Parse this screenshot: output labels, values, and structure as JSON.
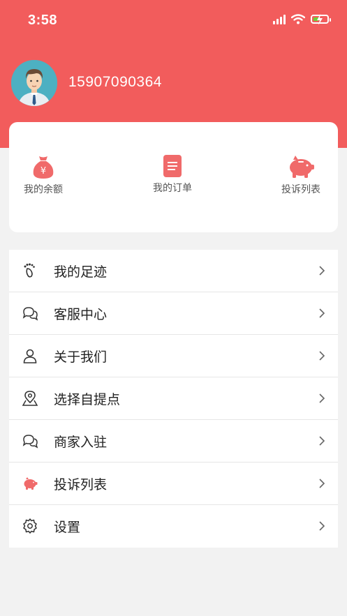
{
  "status_bar": {
    "time": "3:58"
  },
  "profile": {
    "phone": "15907090364"
  },
  "quick_actions": [
    {
      "label": "我的余额",
      "icon": "money-bag-icon"
    },
    {
      "label": "我的订单",
      "icon": "order-document-icon"
    },
    {
      "label": "投诉列表",
      "icon": "piggy-bank-icon"
    }
  ],
  "menu": [
    {
      "label": "我的足迹",
      "icon": "footprint-icon"
    },
    {
      "label": "客服中心",
      "icon": "chat-bubbles-icon"
    },
    {
      "label": "关于我们",
      "icon": "person-icon"
    },
    {
      "label": "选择自提点",
      "icon": "location-pin-icon"
    },
    {
      "label": "商家入驻",
      "icon": "chat-bubbles-icon"
    },
    {
      "label": "投诉列表",
      "icon": "piggy-bank-icon"
    },
    {
      "label": "设置",
      "icon": "gear-icon"
    }
  ],
  "colors": {
    "brand": "#f25c5c",
    "icon_red": "#f06a6a",
    "battery": "#6ad13a"
  }
}
